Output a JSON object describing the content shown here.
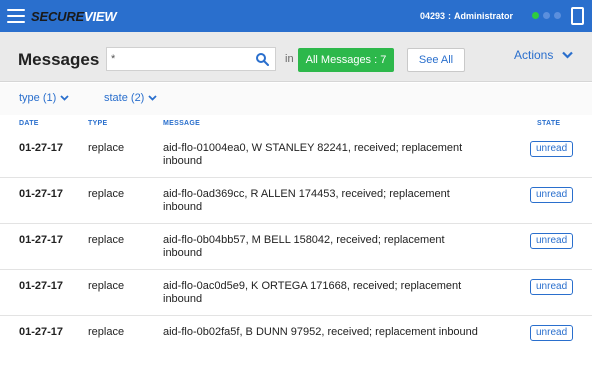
{
  "app": {
    "logo_secure": "SECURE",
    "logo_view": "VIEW",
    "user_id": "04293",
    "user_role": "Administrator"
  },
  "colors": {
    "topbar": "#2a6fcd",
    "accent": "#2a6fcd",
    "success": "#2db84b",
    "status_online": "#2ecc40"
  },
  "toolbar": {
    "title": "Messages",
    "search_value": "*",
    "in_label": "in",
    "all_messages_label": "All Messages : 7",
    "see_all_label": "See All",
    "actions_label": "Actions"
  },
  "filters": [
    {
      "label": "type (1)"
    },
    {
      "label": "state (2)"
    }
  ],
  "table": {
    "columns": [
      "DATE",
      "TYPE",
      "MESSAGE",
      "STATE"
    ],
    "rows": [
      {
        "date": "01-27-17",
        "type": "replace",
        "message": "aid-flo-01004ea0, W STANLEY 82241, received; replacement inbound",
        "state": "unread"
      },
      {
        "date": "01-27-17",
        "type": "replace",
        "message": "aid-flo-0ad369cc, R ALLEN 174453, received; replacement inbound",
        "state": "unread"
      },
      {
        "date": "01-27-17",
        "type": "replace",
        "message": "aid-flo-0b04bb57, M BELL 158042, received; replacement inbound",
        "state": "unread"
      },
      {
        "date": "01-27-17",
        "type": "replace",
        "message": "aid-flo-0ac0d5e9, K ORTEGA 171668, received; replacement inbound",
        "state": "unread"
      },
      {
        "date": "01-27-17",
        "type": "replace",
        "message": "aid-flo-0b02fa5f, B DUNN 97952, received; replacement inbound",
        "state": "unread"
      }
    ]
  }
}
